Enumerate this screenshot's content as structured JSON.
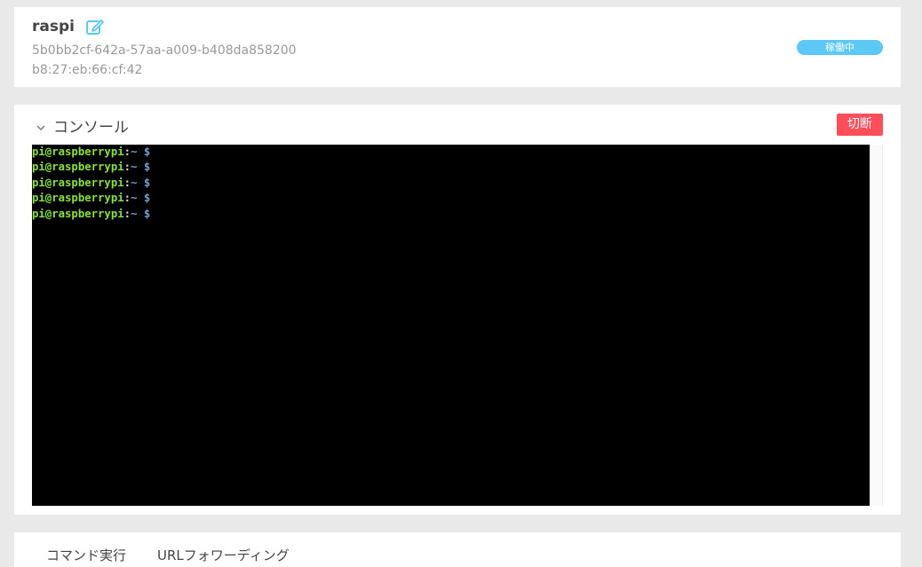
{
  "device": {
    "name": "raspi",
    "id": "5b0bb2cf-642a-57aa-a009-b408da858200",
    "mac": "b8:27:eb:66:cf:42",
    "status": "稼働中",
    "edit_icon": "edit-icon",
    "status_color": "#5bc8f5"
  },
  "console": {
    "title": "コンソール",
    "collapse_icon": "chevron-down-icon",
    "disconnect_label": "切断",
    "disconnect_color": "#ff4d5a",
    "lines": [
      {
        "user": "pi@raspberrypi",
        "sep": ":",
        "path": "~",
        "prompt": " $"
      },
      {
        "user": "pi@raspberrypi",
        "sep": ":",
        "path": "~",
        "prompt": " $"
      },
      {
        "user": "pi@raspberrypi",
        "sep": ":",
        "path": "~",
        "prompt": " $"
      },
      {
        "user": "pi@raspberrypi",
        "sep": ":",
        "path": "~",
        "prompt": " $"
      },
      {
        "user": "pi@raspberrypi",
        "sep": ":",
        "path": "~",
        "prompt": " $"
      }
    ]
  },
  "tabs": [
    {
      "label": "コマンド実行"
    },
    {
      "label": "URLフォワーディング"
    }
  ]
}
